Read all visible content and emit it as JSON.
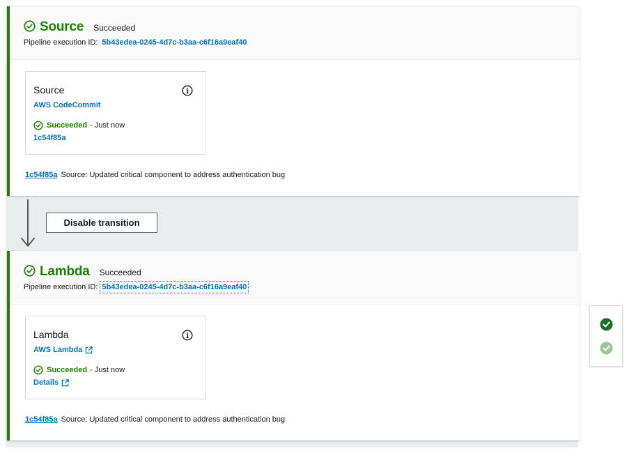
{
  "colors": {
    "success": "#1d8102",
    "link": "#0073bb",
    "text": "#16191f",
    "canvas": "#eaeded"
  },
  "stages": [
    {
      "name": "Source",
      "status": "Succeeded",
      "execution_label": "Pipeline execution ID:",
      "execution_id": "5b43edea-0245-4d7c-b3aa-c6f16a9eaf40",
      "action": {
        "title": "Source",
        "provider": "AWS CodeCommit",
        "status": "Succeeded",
        "time": "- Just now",
        "link": "1c54f85a"
      },
      "commit_id": "1c54f85a",
      "commit_message": "Source: Updated critical component to address authentication bug"
    },
    {
      "name": "Lambda",
      "status": "Succeeded",
      "execution_label": "Pipeline execution ID:",
      "execution_id": "5b43edea-0245-4d7c-b3aa-c6f16a9eaf40",
      "action": {
        "title": "Lambda",
        "provider": "AWS Lambda",
        "status": "Succeeded",
        "time": "- Just now",
        "link": "Details"
      },
      "commit_id": "1c54f85a",
      "commit_message": "Source: Updated critical component to address authentication bug"
    }
  ],
  "transition": {
    "button_label": "Disable transition"
  },
  "icons": {
    "stage_status": "check-circle-icon",
    "info": "info-icon",
    "external": "external-link-icon",
    "arrow": "arrow-down-icon",
    "side_panel": [
      "check-filled-dark-icon",
      "check-filled-light-icon"
    ]
  }
}
